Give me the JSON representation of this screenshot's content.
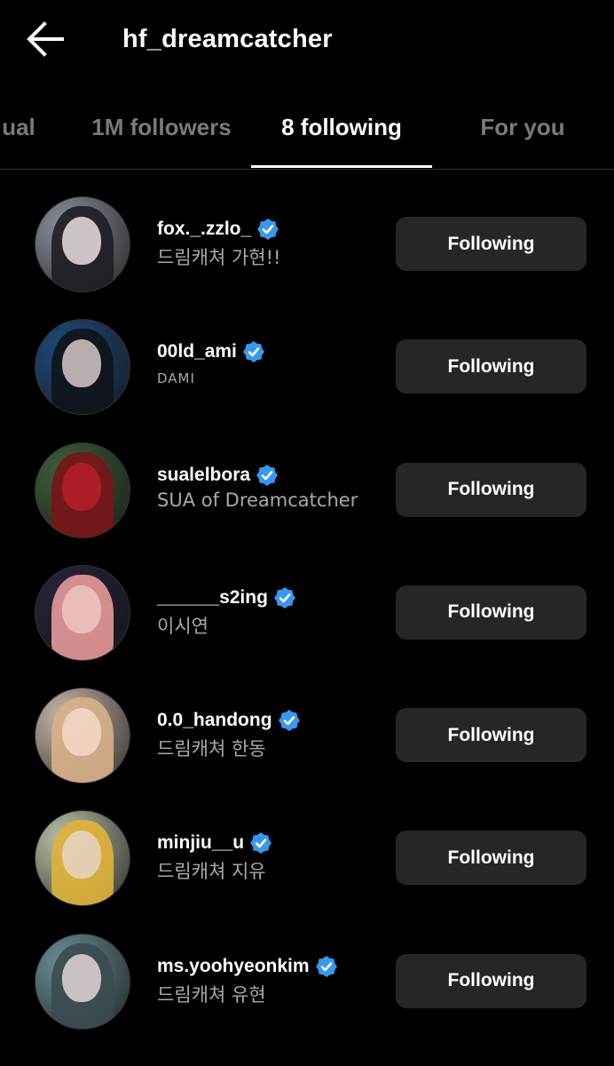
{
  "header": {
    "title": "hf_dreamcatcher",
    "back_icon": "arrow-left-icon"
  },
  "tabs": [
    {
      "label": "ual",
      "active": false
    },
    {
      "label": "1M followers",
      "active": false
    },
    {
      "label": "8 following",
      "active": true
    },
    {
      "label": "For you",
      "active": false
    }
  ],
  "accounts": [
    {
      "username": "fox._.zzlo_",
      "subtitle": "드림캐쳐 가현!!",
      "verified": true,
      "button": "Following",
      "avatar_colors": [
        "#8a8f9a",
        "#e9dfe0",
        "#1d1d22"
      ]
    },
    {
      "username": "00ld_ami",
      "subtitle": "DAMI",
      "verified": true,
      "button": "Following",
      "avatar_colors": [
        "#1f4a7a",
        "#d6c9c8",
        "#101318"
      ]
    },
    {
      "username": "sualelbora",
      "subtitle": "SUA of  Dreamcatcher",
      "verified": true,
      "button": "Following",
      "avatar_colors": [
        "#3f5e3a",
        "#b5202a",
        "#7a1418"
      ]
    },
    {
      "username": "______s2ing",
      "subtitle": "이시연",
      "verified": true,
      "button": "Following",
      "avatar_colors": [
        "#28243a",
        "#f0c6c2",
        "#e59a9a"
      ]
    },
    {
      "username": "0.0_handong",
      "subtitle": "드림캐쳐 한동",
      "verified": true,
      "button": "Following",
      "avatar_colors": [
        "#c9b7aa",
        "#f3d8c8",
        "#d8b08a"
      ]
    },
    {
      "username": "minjiu__u",
      "subtitle": "드림캐쳐 지유",
      "verified": true,
      "button": "Following",
      "avatar_colors": [
        "#b9c2a6",
        "#e8d3c4",
        "#e0b23a"
      ]
    },
    {
      "username": "ms.yoohyeonkim",
      "subtitle": "드림캐쳐 유현",
      "verified": true,
      "button": "Following",
      "avatar_colors": [
        "#6a8f94",
        "#e3d6d6",
        "#3b4a4f"
      ]
    }
  ],
  "colors": {
    "background": "#000000",
    "button_bg": "#262626",
    "verified": "#3897f0",
    "muted_text": "#a8a8a8",
    "inactive_tab": "#7a7a7a"
  }
}
